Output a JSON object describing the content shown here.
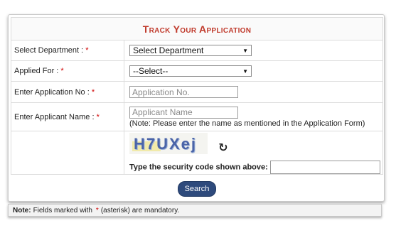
{
  "form": {
    "title": "Track Your Application",
    "department_label": "Select Department : ",
    "department_value": "Select Department",
    "applied_label": "Applied For : ",
    "applied_value": "--Select--",
    "appno_label": "Enter Application No : ",
    "appno_placeholder": "Application No.",
    "name_label": "Enter Applicant Name : ",
    "name_placeholder": "Applicant Name",
    "name_note": "(Note: Please enter the name as mentioned in the Application Form)",
    "captcha_text": "H7UXej",
    "security_label": "Type the security code shown above:",
    "required_mark": "*",
    "search_label": "Search"
  },
  "footer": {
    "note_label": "Note:",
    "note_text_a": "Fields marked with",
    "note_star": "*",
    "note_text_b": "(asterisk) are mandatory."
  }
}
